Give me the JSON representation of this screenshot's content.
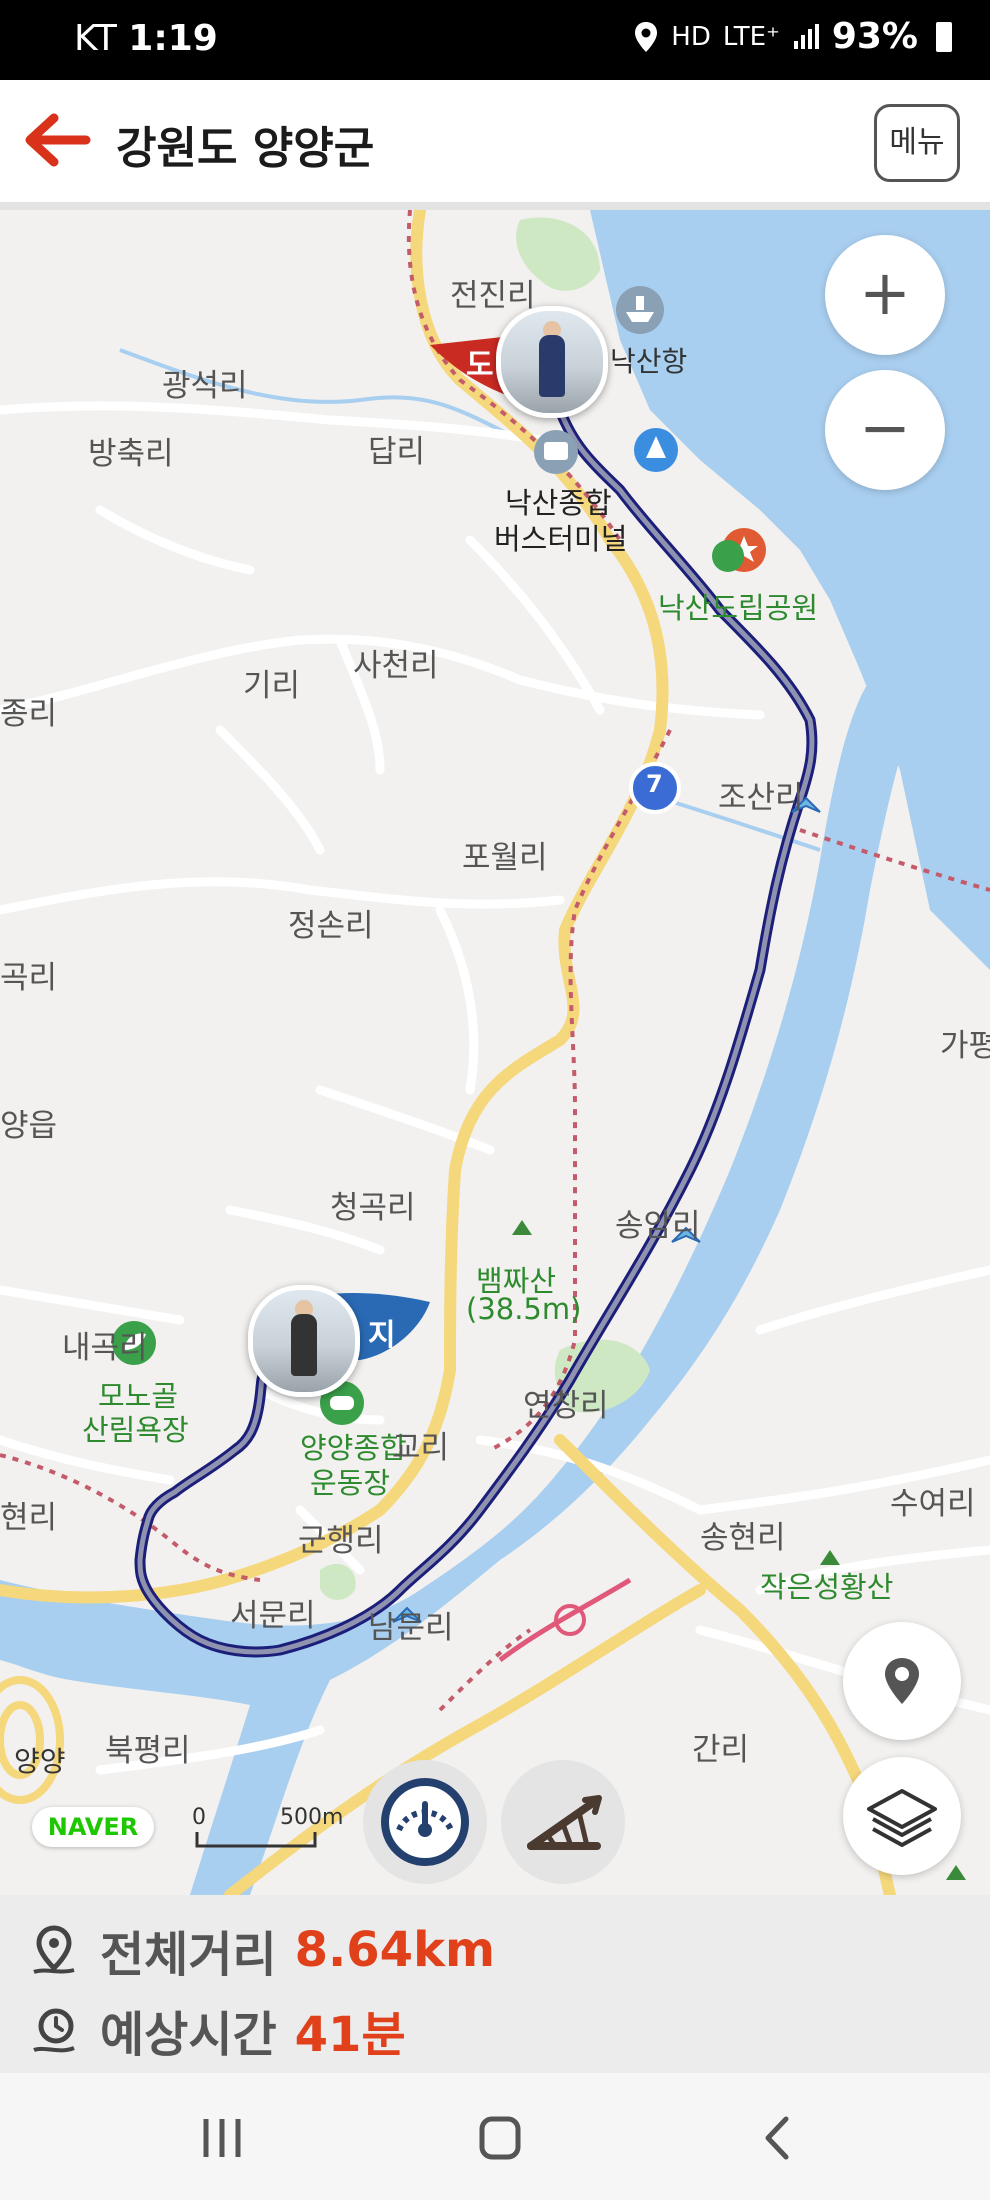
{
  "status_bar": {
    "carrier": "KT",
    "time": "1:19",
    "network": "LTE⁺",
    "battery": "93%"
  },
  "header": {
    "title": "강원도 양양군",
    "menu_label": "메뉴"
  },
  "map": {
    "zoom_in": "+",
    "zoom_out": "−",
    "labels": {
      "jeonjin": "전진리",
      "naksan_port": "낙산항",
      "gwangseok": "광석리",
      "bangchuk": "방축리",
      "dap": "답리",
      "terminal_1": "낙산종합",
      "terminal_2": "버스터미널",
      "naksan_park": "낙산도립공원",
      "giri": "기리",
      "sacheon": "사천리",
      "jori_left": "종리",
      "route7": "7",
      "josan": "조산리",
      "powol": "포월리",
      "jeongson": "정손리",
      "gokri": "곡리",
      "gajang": "가평",
      "yangeup": "양읍",
      "cheonggok": "청곡리",
      "songam": "송암리",
      "baemjae_1": "뱀짜산",
      "baemjae_2": "(38.5m)",
      "nae": "내곡리",
      "monogol_1": "모노골",
      "monogol_2": "산림욕장",
      "stadium_1": "양양종합",
      "stadium_2": "운동장",
      "gyori": "교리",
      "yeonchang": "연창리",
      "suyeo": "수여리",
      "hyeonri": "현리",
      "gunhaeng": "군행리",
      "songhyeon": "송현리",
      "jakeunseong": "작은성황산",
      "seomun": "서문리",
      "nammun": "남문리",
      "bukpyeong": "북평리",
      "yangyang_ic": "양양",
      "ganri": "간리",
      "start_flag": "도",
      "end_flag": "지"
    },
    "naver_logo": "NAVER",
    "scale": {
      "start": "0",
      "end": "500m"
    }
  },
  "route_info": {
    "distance_label": "전체거리",
    "distance_value": "8.64km",
    "time_label": "예상시간",
    "time_value": "41분"
  },
  "colors": {
    "accent": "#e0401a",
    "water": "#a9cff0",
    "route": "#2a2fa8",
    "start_flag": "#c92a22",
    "end_flag": "#2a6ab4"
  },
  "icons": [
    "back-arrow-icon",
    "location-pin-icon",
    "layers-icon",
    "speedometer-icon",
    "slope-icon",
    "distance-pin-icon",
    "clock-route-icon"
  ]
}
